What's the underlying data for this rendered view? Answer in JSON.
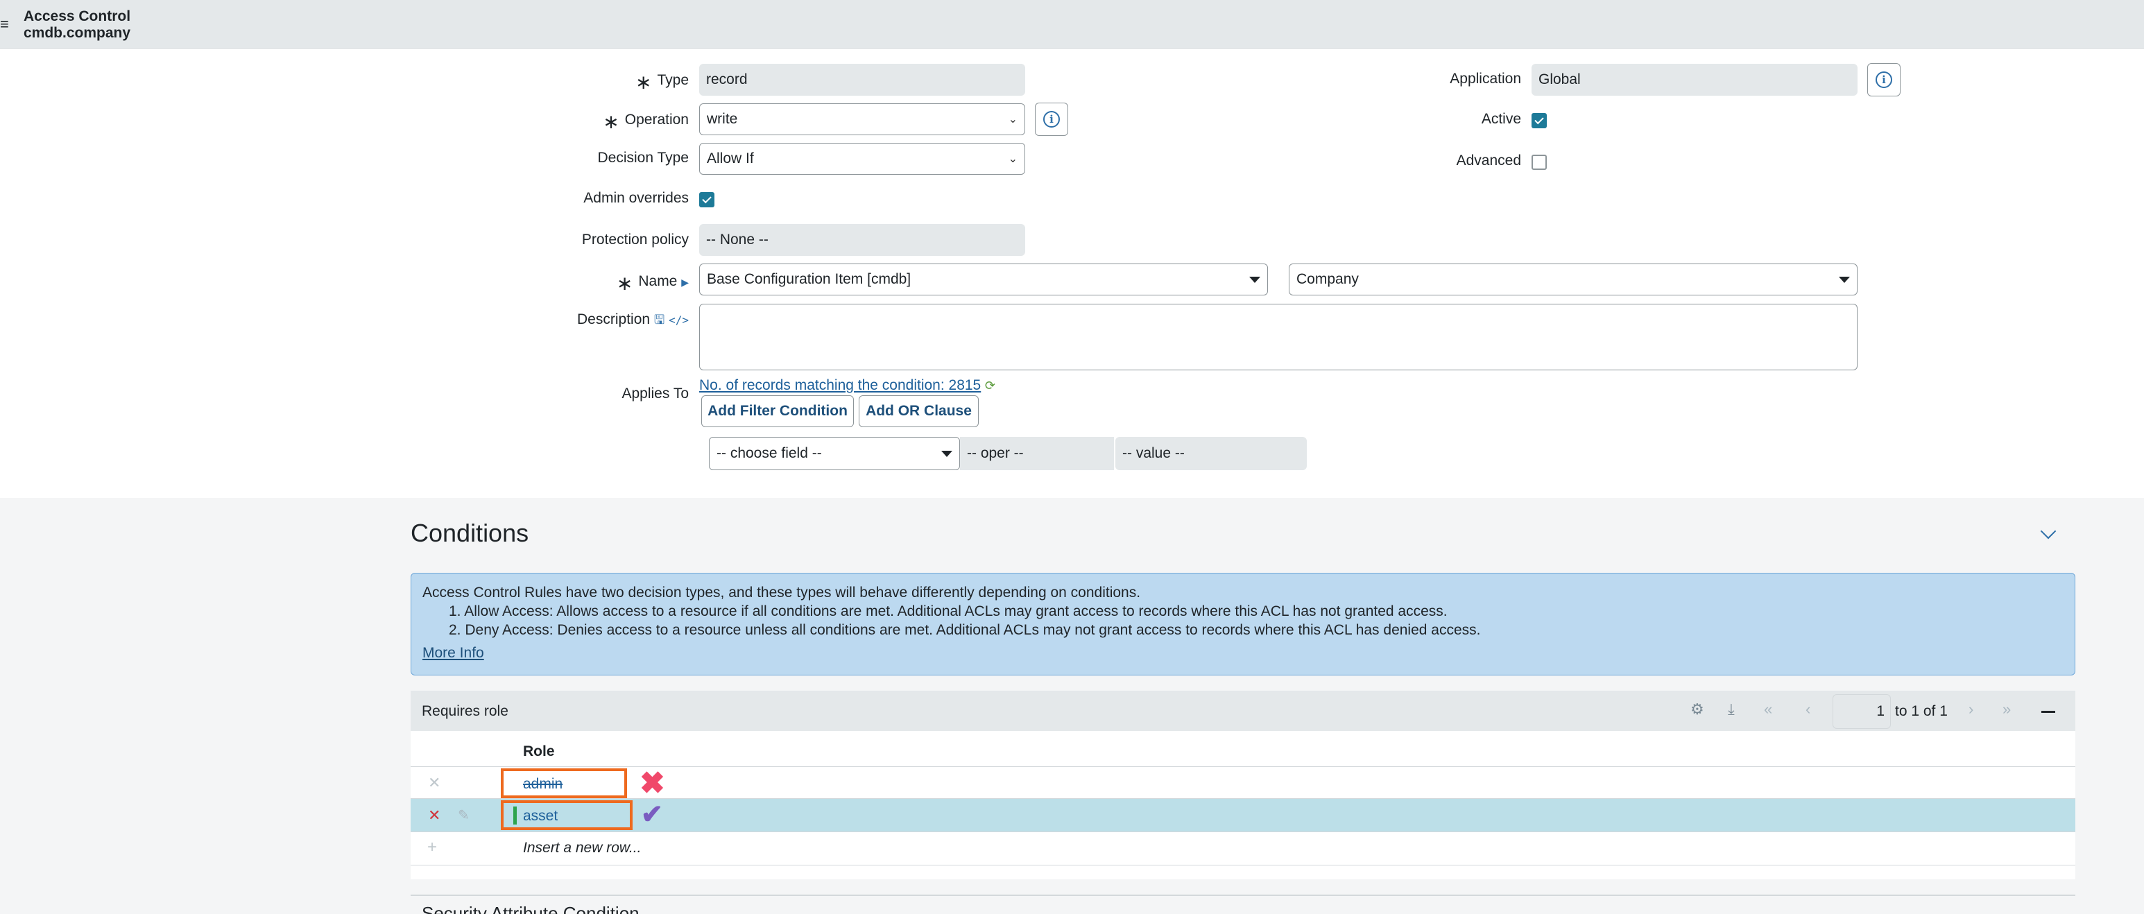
{
  "header": {
    "menu_icon": "hamburger-icon",
    "title_line1": "Access Control",
    "title_line2": "cmdb.company"
  },
  "form": {
    "type": {
      "label": "Type",
      "value": "record"
    },
    "operation": {
      "label": "Operation",
      "value": "write"
    },
    "decision_type": {
      "label": "Decision Type",
      "value": "Allow If"
    },
    "admin_overrides": {
      "label": "Admin overrides",
      "checked": true
    },
    "protection_policy": {
      "label": "Protection policy",
      "value": "-- None --"
    },
    "name": {
      "label": "Name",
      "table_value": "Base Configuration Item [cmdb]",
      "field_value": "Company"
    },
    "description": {
      "label": "Description",
      "value": ""
    },
    "application": {
      "label": "Application",
      "value": "Global"
    },
    "active": {
      "label": "Active",
      "checked": true
    },
    "advanced": {
      "label": "Advanced",
      "checked": false
    },
    "applies_to": {
      "label": "Applies To",
      "records_link": "No. of records matching the condition: 2815",
      "add_filter_label": "Add Filter Condition",
      "add_or_label": "Add OR Clause",
      "field_placeholder": "-- choose field --",
      "oper_placeholder": "-- oper --",
      "value_placeholder": "-- value --"
    }
  },
  "conditions": {
    "title": "Conditions",
    "info_intro": "Access Control Rules have two decision types, and these types will behave differently depending on conditions.",
    "info_item1": "1. Allow Access: Allows access to a resource if all conditions are met. Additional ACLs may grant access to records where this ACL has not granted access.",
    "info_item2": "2. Deny Access: Denies access to a resource unless all conditions are met. Additional ACLs may not grant access to records where this ACL has denied access.",
    "more_info": "More Info"
  },
  "roles_list": {
    "title": "Requires role",
    "page_value": "1",
    "page_text": "to 1 of 1",
    "column": "Role",
    "rows": [
      {
        "role": "admin",
        "deleted": true
      },
      {
        "role": "asset",
        "deleted": false
      }
    ],
    "insert_label": "Insert a new row..."
  },
  "next_section": {
    "title": "Security Attribute Condition"
  }
}
